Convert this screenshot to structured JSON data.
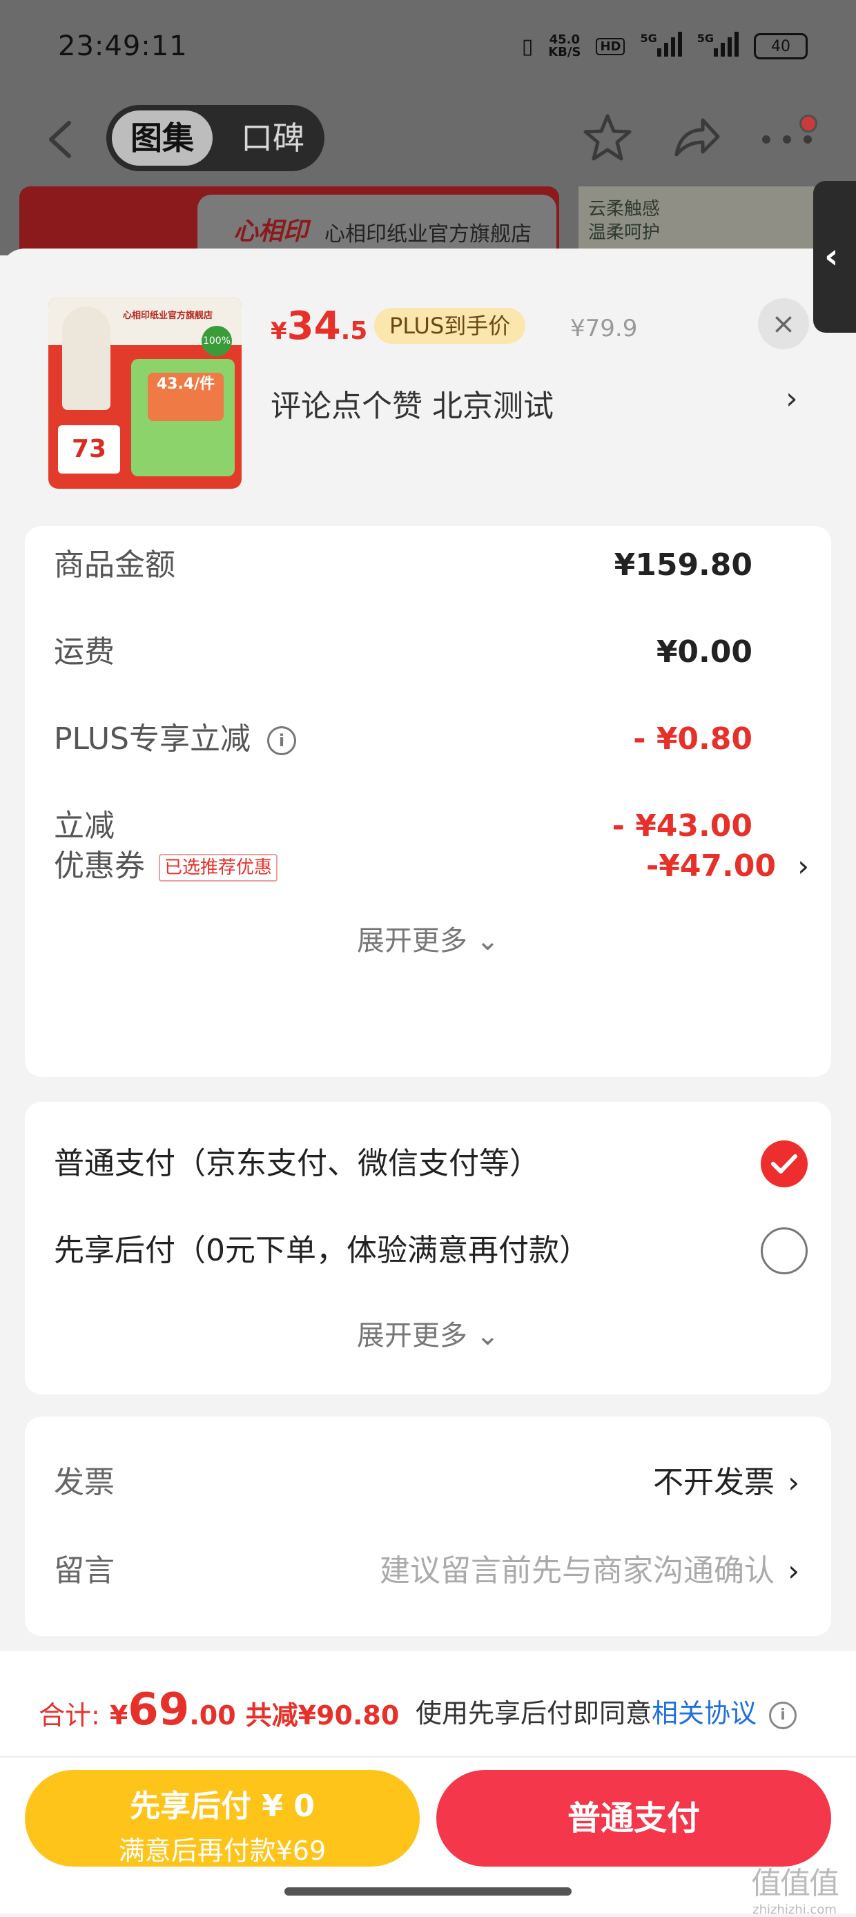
{
  "status_bar": {
    "time": "23:49:11",
    "net_speed": "45.0",
    "net_unit": "KB/S",
    "hd": "HD",
    "sig1": "5G",
    "sig2": "5G",
    "battery": "40"
  },
  "nav": {
    "tab_gallery": "图集",
    "tab_reviews": "口碑"
  },
  "banner": {
    "logo": "心相印",
    "store_name": "心相印纸业官方旗舰店",
    "promo_line1": "云柔触感",
    "promo_line2": "温柔呵护"
  },
  "product": {
    "thumb_brand": "心相印纸业官方旗舰店",
    "thumb_price": "73",
    "thumb_badge": "43.4/件",
    "thumb_100": "100%",
    "currency": "¥",
    "price_int": "34",
    "price_dec": ".5",
    "plus_label": "PLUS到手价",
    "original_price": "¥79.9",
    "title": "评论点个赞  北京测试",
    "close": "×"
  },
  "fees": {
    "goods_label": "商品金额",
    "goods_value": "¥159.80",
    "shipping_label": "运费",
    "shipping_value": "¥0.00",
    "plus_label": "PLUS专享立减",
    "plus_value": "- ¥0.80",
    "discount_label": "立减",
    "discount_value": "- ¥43.00",
    "coupon_label": "优惠券",
    "coupon_tag": "已选推荐优惠",
    "coupon_value": "-¥47.00",
    "expand": "展开更多"
  },
  "payment": {
    "normal_label": "普通支付（京东支付、微信支付等）",
    "later_label": "先享后付（0元下单，体验满意再付款）",
    "expand": "展开更多"
  },
  "options": {
    "invoice_label": "发票",
    "invoice_value": "不开发票",
    "message_label": "留言",
    "message_placeholder": "建议留言前先与商家沟通确认"
  },
  "footer": {
    "total_label": "合计:",
    "total_currency": "¥",
    "total_int": "69",
    "total_dec": ".00",
    "total_discount": "共减¥90.80",
    "agree_text": "使用先享后付即同意",
    "agree_link": "相关协议",
    "btn_later_line1": "先享后付 ¥ 0",
    "btn_later_line2": "满意后再付款¥69",
    "btn_pay": "普通支付"
  },
  "watermark": {
    "glyph": "值值值",
    "text": "zhizhizhi.com"
  },
  "colors": {
    "accent_red": "#e8302a",
    "pay_button": "#f4374a",
    "later_button": "#ffc41a",
    "link_blue": "#1f6fe0"
  }
}
